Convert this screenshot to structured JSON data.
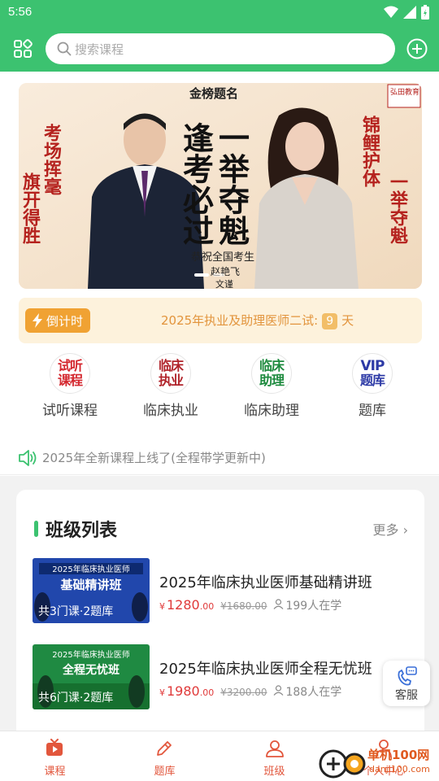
{
  "status_bar": {
    "time": "5:56"
  },
  "header": {
    "search_placeholder": "搜索课程"
  },
  "banner": {
    "brand": "弘田教育",
    "headline_top": "金榜题名",
    "left_verse": [
      "考场挥毫",
      "旗开得胜"
    ],
    "center_verse": [
      "逢考必过",
      "一举夺魁"
    ],
    "right_verse": [
      "锦鲤护体",
      "一举夺魁"
    ],
    "congrats": "恭祝全国考生",
    "signature": "赵艳飞",
    "sig_suffix": "文谨"
  },
  "countdown": {
    "badge": "倒计时",
    "text": "2025年执业及助理医师二试:",
    "days": "9",
    "unit": "天"
  },
  "quick_nav": [
    {
      "circle": "试听课程",
      "label": "试听课程",
      "color": "#d4282f"
    },
    {
      "circle": "临床执业",
      "label": "临床执业",
      "color": "#b0232a"
    },
    {
      "circle": "临床助理",
      "label": "临床助理",
      "color": "#1d8a3e"
    },
    {
      "circle": "VIP题库",
      "label": "题库",
      "color": "#2d3aa6"
    }
  ],
  "notice": {
    "text": "2025年全新课程上线了(全程带学更新中)"
  },
  "class_list": {
    "title": "班级列表",
    "more": "更多",
    "courses": [
      {
        "thumb_title": "2025年临床执业医师",
        "thumb_main": "基础精讲班",
        "thumb_badge": "共3门课·2题库",
        "title": "2025年临床执业医师基础精讲班",
        "currency": "¥",
        "price": "1280",
        "price_dec": ".00",
        "orig_price": "¥1680.00",
        "learners": "199人在学"
      },
      {
        "thumb_title": "2025年临床执业医师",
        "thumb_main": "全程无忧班",
        "thumb_badge": "共6门课·2题库",
        "title": "2025年临床执业医师全程无忧班",
        "currency": "¥",
        "price": "1980",
        "price_dec": ".00",
        "orig_price": "¥3200.00",
        "learners": "188人在学"
      }
    ]
  },
  "customer_service": {
    "label": "客服"
  },
  "tabs": [
    {
      "label": "课程"
    },
    {
      "label": "题库"
    },
    {
      "label": "班级"
    },
    {
      "label": "个人中心"
    }
  ],
  "watermark": {
    "name": "单机100网",
    "url": "danji100.com"
  },
  "colors": {
    "brand_green": "#3cc270",
    "accent_orange": "#f0a233",
    "price_red": "#e03a3a"
  }
}
